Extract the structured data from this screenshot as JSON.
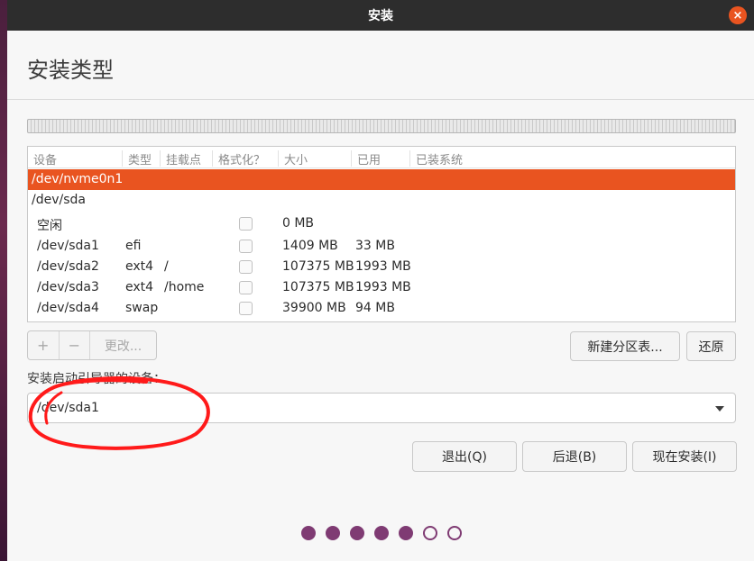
{
  "window": {
    "title": "安装",
    "close_glyph": "×"
  },
  "page": {
    "title": "安装类型"
  },
  "table": {
    "headers": [
      "设备",
      "类型",
      "挂载点",
      "格式化？",
      "大小",
      "已用",
      "已装系统"
    ],
    "disks": [
      "/dev/nvme0n1",
      "/dev/sda"
    ],
    "partitions": [
      {
        "device": "空闲",
        "type": "",
        "mount": "",
        "size": "0 MB",
        "used": ""
      },
      {
        "device": "/dev/sda1",
        "type": "efi",
        "mount": "",
        "size": "1409 MB",
        "used": "33 MB"
      },
      {
        "device": "/dev/sda2",
        "type": "ext4",
        "mount": "/",
        "size": "107375 MB",
        "used": "1993 MB"
      },
      {
        "device": "/dev/sda3",
        "type": "ext4",
        "mount": "/home",
        "size": "107375 MB",
        "used": "1993 MB"
      },
      {
        "device": "/dev/sda4",
        "type": "swap",
        "mount": "",
        "size": "39900 MB",
        "used": "94 MB"
      }
    ]
  },
  "toolbar": {
    "add": "+",
    "remove": "−",
    "change": "更改..."
  },
  "actions": {
    "new_table": "新建分区表...",
    "revert": "还原"
  },
  "boot": {
    "label": "安装启动引导器的设备：",
    "value": "/dev/sda1"
  },
  "buttons": {
    "quit": "退出(Q)",
    "back": "后退(B)",
    "install": "现在安装(I)"
  },
  "progress": {
    "total_steps": 7,
    "completed_steps": 5
  },
  "colors": {
    "accent": "#e95420",
    "step_dot": "#7f3b73",
    "annotation": "#ff1a1a"
  },
  "icons": {
    "close": "close-icon",
    "dropdown": "chevron-down-icon"
  }
}
